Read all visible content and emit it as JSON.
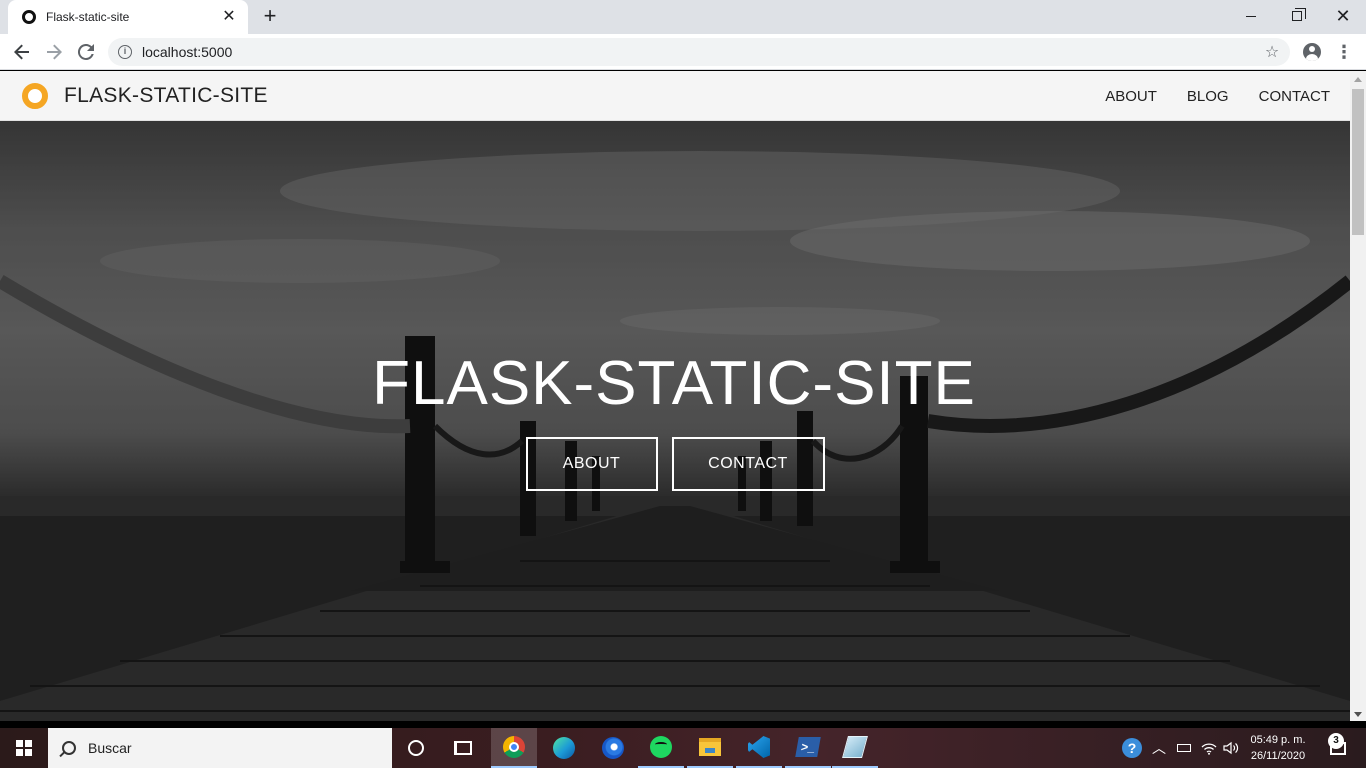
{
  "browser": {
    "tab_title": "Flask-static-site",
    "tab_close": "✕",
    "new_tab": "+",
    "url": "localhost:5000",
    "window_controls": {
      "minimize": "minimize",
      "maximize": "restore",
      "close": "✕"
    }
  },
  "site": {
    "brand": "FLASK-STATIC-SITE",
    "brand_color": "#f5a623",
    "nav": [
      {
        "label": "ABOUT"
      },
      {
        "label": "BLOG"
      },
      {
        "label": "CONTACT"
      }
    ],
    "hero": {
      "title": "FLASK-STATIC-SITE",
      "buttons": [
        {
          "label": "ABOUT"
        },
        {
          "label": "CONTACT"
        }
      ]
    }
  },
  "taskbar": {
    "search_placeholder": "Buscar",
    "apps": [
      "cortana-icon",
      "task-view-icon",
      "chrome-icon",
      "edge-icon",
      "firefox-icon",
      "spotify-icon",
      "file-explorer-icon",
      "vscode-icon",
      "powershell-icon",
      "misc-app-icon"
    ],
    "clock_time": "05:49 p. m.",
    "clock_date": "26/11/2020",
    "notification_count": "3"
  }
}
